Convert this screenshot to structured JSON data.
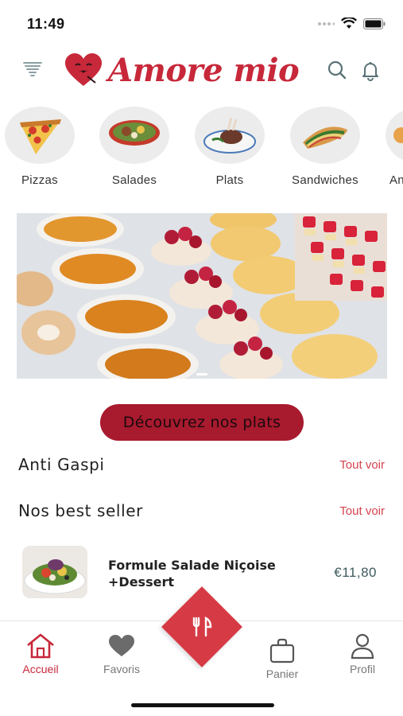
{
  "status_bar": {
    "time": "11:49"
  },
  "app": {
    "name": "Amore mio",
    "brand_color": "#c7283a"
  },
  "header": {
    "menu_icon": "tornado-menu-icon",
    "search_icon": "search-icon",
    "notifications_icon": "bell-icon"
  },
  "categories": [
    {
      "label": "Pizzas",
      "icon": "pizza-icon"
    },
    {
      "label": "Salades",
      "icon": "salad-bowl-icon"
    },
    {
      "label": "Plats",
      "icon": "plate-dish-icon"
    },
    {
      "label": "Sandwiches",
      "icon": "sandwich-icon"
    },
    {
      "label": "An",
      "icon": "category-icon"
    }
  ],
  "cta": {
    "label": "Découvrez nos plats",
    "color": "#a81a2e"
  },
  "sections": {
    "anti_gaspi": {
      "title": "Anti Gaspi",
      "see_all": "Tout voir"
    },
    "best_seller": {
      "title": "Nos best seller",
      "see_all": "Tout voir"
    }
  },
  "product": {
    "name_line1": "Formule Salade Niçoise",
    "name_line2": "+Dessert",
    "price": "€11,80"
  },
  "bottom_nav": {
    "home": "Accueil",
    "favorites": "Favoris",
    "cart": "Panier",
    "profile": "Profil",
    "center_icon": "fork-knife-icon",
    "accent": "#d63b45"
  }
}
